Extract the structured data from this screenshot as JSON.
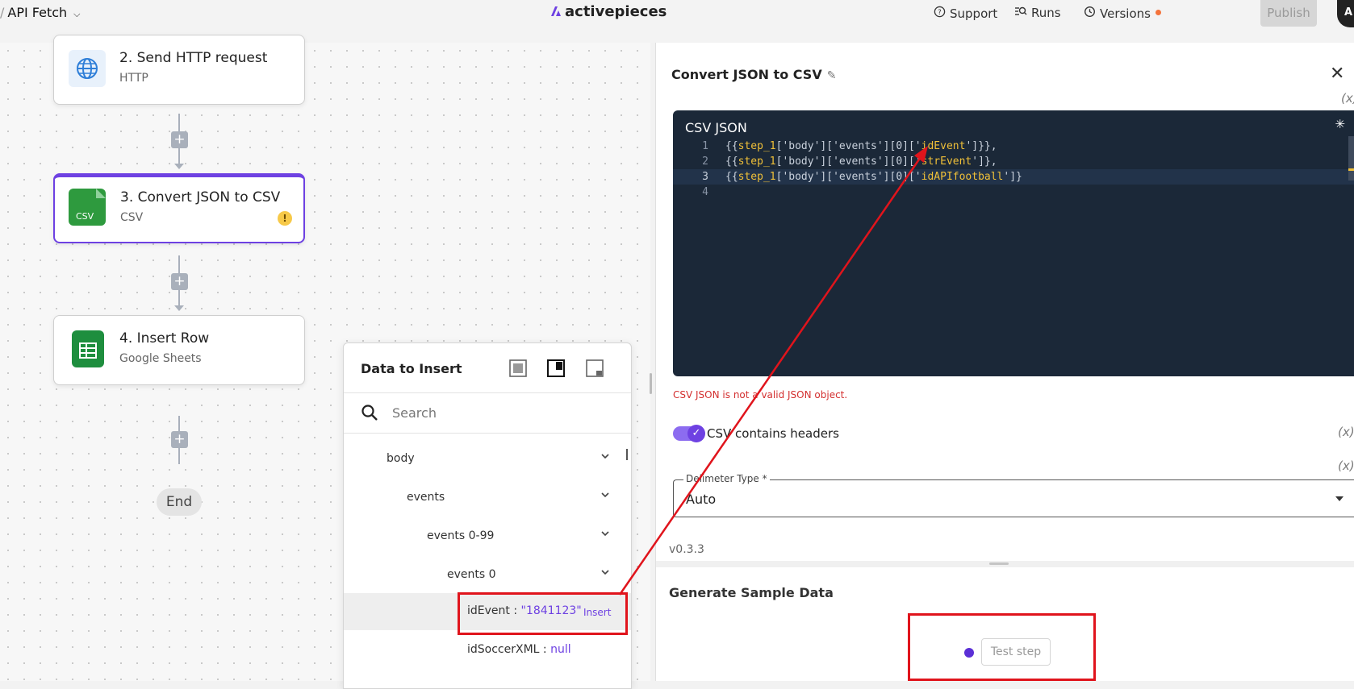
{
  "topbar": {
    "flow_name": "API Fetch",
    "brand": "activepieces",
    "support": "Support",
    "runs": "Runs",
    "versions": "Versions",
    "publish": "Publish",
    "avatar_initial": "A"
  },
  "canvas": {
    "steps": [
      {
        "title": "2. Send HTTP request",
        "subtitle": "HTTP"
      },
      {
        "title": "3. Convert JSON to CSV",
        "subtitle": "CSV",
        "icon_text": "CSV"
      },
      {
        "title": "4. Insert Row",
        "subtitle": "Google Sheets"
      }
    ],
    "add_symbol": "+",
    "end_label": "End"
  },
  "data_to_insert": {
    "title": "Data to Insert",
    "search_placeholder": "Search",
    "tree": [
      {
        "label": "body"
      },
      {
        "label": "events"
      },
      {
        "label": "events 0-99"
      },
      {
        "label": "events 0"
      },
      {
        "key": "idEvent : ",
        "value": "\"1841123\"",
        "action": "Insert"
      },
      {
        "key": "idSoccerXML : ",
        "value": "null"
      }
    ]
  },
  "panel": {
    "title": "Convert JSON to CSV",
    "fx_label": "(x)",
    "editor": {
      "label": "CSV JSON",
      "line_numbers": [
        "1",
        "2",
        "3",
        "4"
      ],
      "lines": [
        {
          "pre": "{{",
          "var": "step_1",
          "mid": "['body']['events'][0]['",
          "key": "idEvent",
          "post": "']}},"
        },
        {
          "pre": "{{",
          "var": "step_1",
          "mid": "['body']['events'][0]['",
          "key": "strEvent",
          "post": "']},"
        },
        {
          "pre": "{{",
          "var": "step_1",
          "mid": "['body']['events'][0]['",
          "key": "idAPIfootball",
          "post": "']}"
        }
      ]
    },
    "error": "CSV JSON is not a valid JSON object.",
    "headers_toggle": {
      "label": "CSV contains headers",
      "checked": true
    },
    "delimiter": {
      "label": "Delimeter Type *",
      "value": "Auto"
    },
    "version": "v0.3.3",
    "generate_title": "Generate Sample Data",
    "test_step": "Test step"
  },
  "colors": {
    "accent": "#6e41e2",
    "annotation": "#e0141c",
    "editor_bg": "#1b2838",
    "error": "#d32f2f",
    "csv_green": "#2e9a3e",
    "sheets_green": "#1e8e3e"
  }
}
